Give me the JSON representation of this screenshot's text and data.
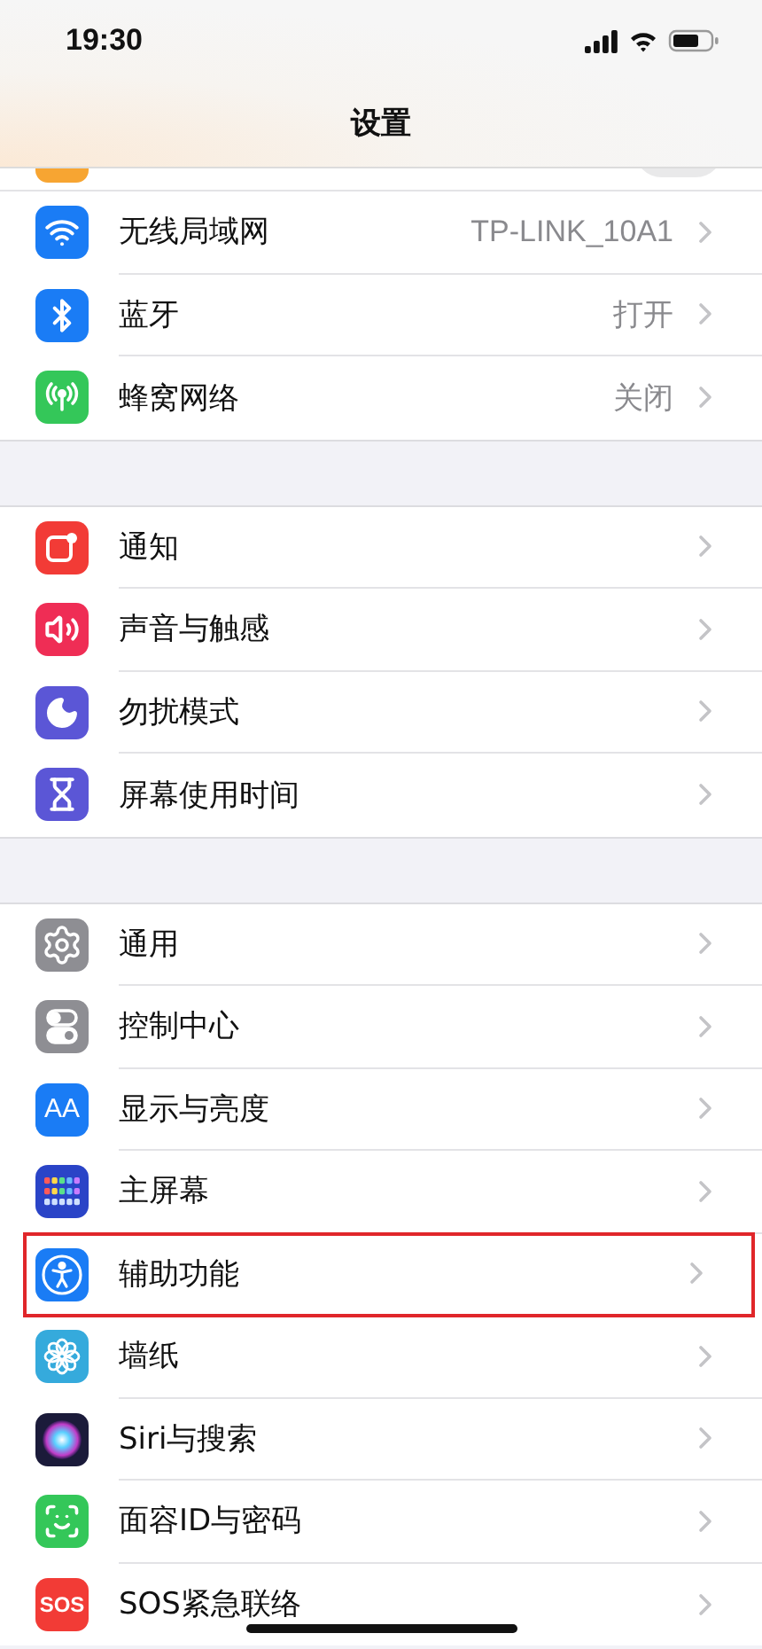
{
  "status_bar": {
    "time": "19:30"
  },
  "nav": {
    "title": "设置"
  },
  "partial_row": {
    "on": false
  },
  "groups": [
    {
      "items": [
        {
          "label": "无线局域网",
          "value": "TP-LINK_10A1",
          "highlighted": false
        },
        {
          "label": "蓝牙",
          "value": "打开",
          "highlighted": false
        },
        {
          "label": "蜂窝网络",
          "value": "关闭",
          "highlighted": false
        }
      ]
    },
    {
      "items": [
        {
          "label": "通知",
          "highlighted": false
        },
        {
          "label": "声音与触感",
          "highlighted": false
        },
        {
          "label": "勿扰模式",
          "highlighted": false
        },
        {
          "label": "屏幕使用时间",
          "highlighted": false
        }
      ]
    },
    {
      "items": [
        {
          "label": "通用",
          "highlighted": false
        },
        {
          "label": "控制中心",
          "highlighted": false
        },
        {
          "label": "显示与亮度",
          "icon_text": "AA",
          "highlighted": false
        },
        {
          "label": "主屏幕",
          "highlighted": false
        },
        {
          "label": "辅助功能",
          "highlighted": true
        },
        {
          "label": "墙纸",
          "highlighted": false
        },
        {
          "label": "Siri与搜索",
          "highlighted": false
        },
        {
          "label": "面容ID与密码",
          "highlighted": false
        },
        {
          "label": "SOS紧急联络",
          "icon_text": "SOS",
          "highlighted": false
        }
      ]
    }
  ]
}
